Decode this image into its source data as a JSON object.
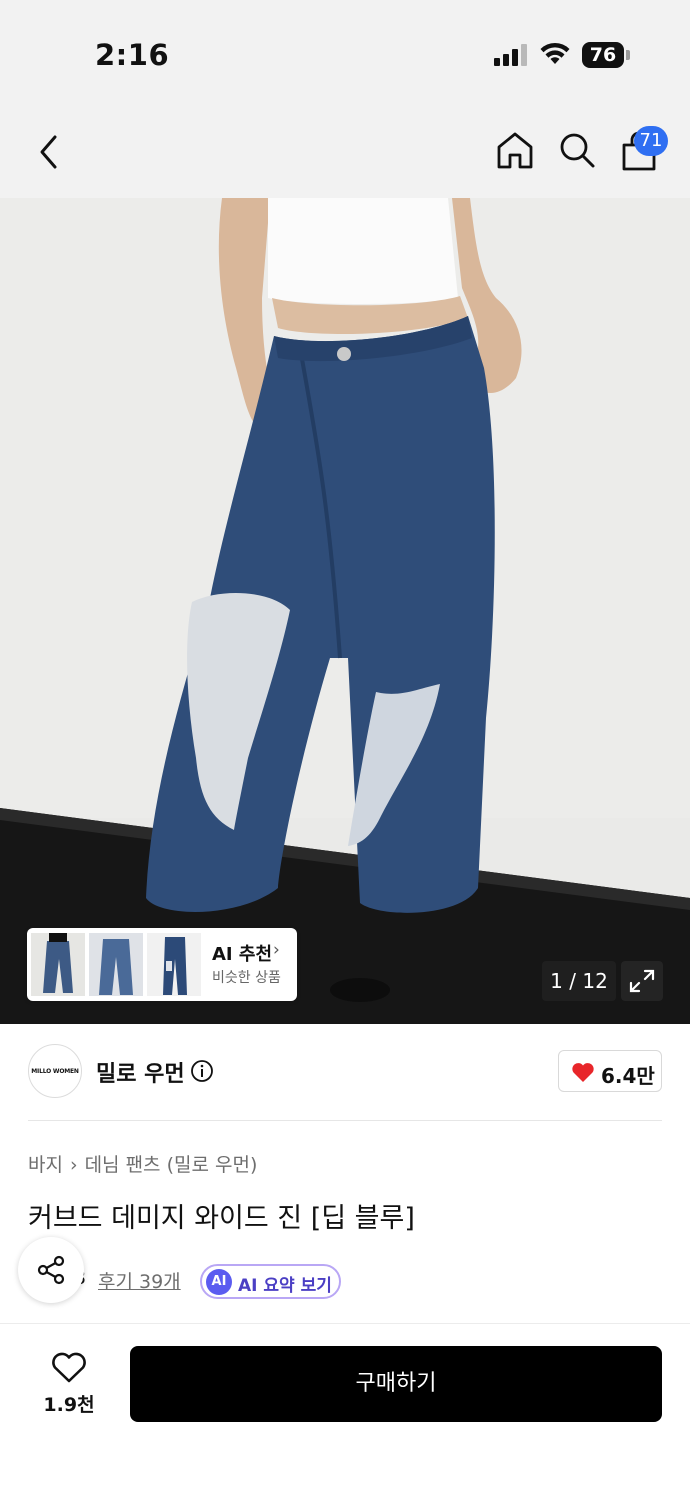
{
  "status_bar": {
    "time": "2:16",
    "battery": "76"
  },
  "nav": {
    "back_icon": "chevron-left-icon",
    "home_icon": "home-icon",
    "search_icon": "search-icon",
    "cart_icon": "shopping-bag-icon",
    "cart_count": "71"
  },
  "hero": {
    "page_indicator": "1 / 12",
    "ai_recommend": {
      "title": "AI 추천",
      "subtitle": "비슷한 상품"
    }
  },
  "brand": {
    "logo_text": "MILLO WOMEN",
    "name": "밀로 우먼",
    "like_count": "6.4만"
  },
  "breadcrumb": {
    "category": "바지",
    "subcategory": "데님 팬츠 (밀로 우먼)"
  },
  "product": {
    "title": "커브드 데미지 와이드 진 [딥 블루]",
    "rating_partial": "3",
    "reviews_label": "후기 39개",
    "ai_summary_label": "AI 요약 보기",
    "ai_badge": "AI"
  },
  "bottom": {
    "wish_count": "1.9천",
    "buy_label": "구매하기"
  },
  "colors": {
    "accent_blue": "#2f6ff2",
    "heart_red": "#e8262a",
    "ai_purple": "#5b5cf0",
    "buy_black": "#000000"
  }
}
